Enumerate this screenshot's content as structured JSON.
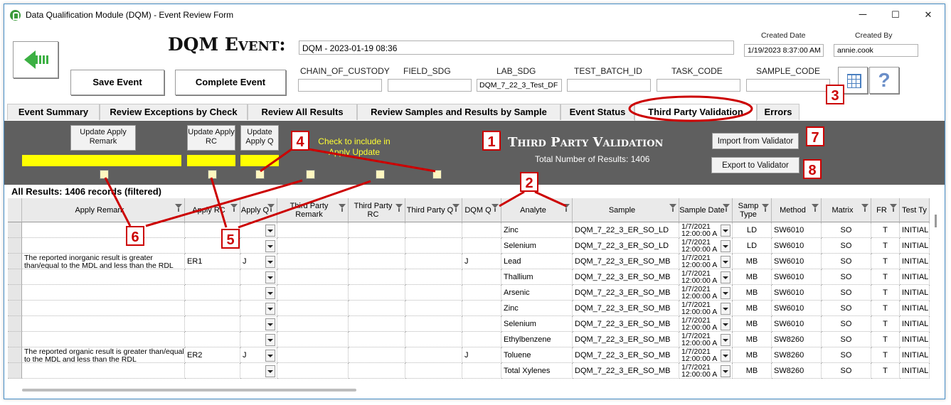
{
  "window": {
    "title": "Data Qualification Module (DQM) - Event Review Form",
    "minimize": "─",
    "maximize": "☐",
    "close": "✕"
  },
  "header": {
    "title": "DQM Event:",
    "event_name": "DQM - 2023-01-19 08:36",
    "created_date_label": "Created Date",
    "created_date": "1/19/2023 8:37:00 AM",
    "created_by_label": "Created By",
    "created_by": "annie.cook",
    "save_label": "Save Event",
    "complete_label": "Complete Event",
    "fields": [
      {
        "label": "CHAIN_OF_CUSTODY",
        "value": ""
      },
      {
        "label": "FIELD_SDG",
        "value": ""
      },
      {
        "label": "LAB_SDG",
        "value": "DQM_7_22_3_Test_DF"
      },
      {
        "label": "TEST_BATCH_ID",
        "value": ""
      },
      {
        "label": "TASK_CODE",
        "value": ""
      },
      {
        "label": "SAMPLE_CODE",
        "value": ""
      }
    ],
    "help_glyph": "?"
  },
  "tabs": [
    "Event Summary",
    "Review Exceptions by Check",
    "Review All Results",
    "Review Samples and Results by Sample",
    "Event Status",
    "Third Party Validation",
    "Errors"
  ],
  "panel": {
    "update_remark": "Update Apply Remark",
    "update_rc": "Update Apply RC",
    "update_q": "Update Apply Q",
    "check_note": "Check to include in Apply Update",
    "title": "Third Party Validation",
    "total": "Total Number of Results: 1406",
    "import_label": "Import from Validator",
    "export_label": "Export to Validator"
  },
  "results_label": "All Results: 1406 records (filtered)",
  "table": {
    "columns": [
      "Apply Remark",
      "Apply RC",
      "Apply Q",
      "Third Party Remark",
      "Third Party RC",
      "Third Party Q",
      "DQM Q",
      "Analyte",
      "Sample",
      "Sample Date",
      "Samp Type",
      "Method",
      "Matrix",
      "FR",
      "Test Ty"
    ],
    "rows": [
      {
        "remark": "",
        "rc": "",
        "q": "",
        "dqmq": "",
        "analyte": "Zinc",
        "sample": "DQM_7_22_3_ER_SO_LD",
        "date": "1/7/2021 12:00:00 A",
        "type": "LD",
        "method": "SW6010",
        "matrix": "SO",
        "fr": "T",
        "test": "INITIAL"
      },
      {
        "remark": "",
        "rc": "",
        "q": "",
        "dqmq": "",
        "analyte": "Selenium",
        "sample": "DQM_7_22_3_ER_SO_LD",
        "date": "1/7/2021 12:00:00 A",
        "type": "LD",
        "method": "SW6010",
        "matrix": "SO",
        "fr": "T",
        "test": "INITIAL"
      },
      {
        "remark": "The reported inorganic result is greater than/equal to the MDL and less than the RDL",
        "rc": "ER1",
        "q": "J",
        "dqmq": "J",
        "analyte": "Lead",
        "sample": "DQM_7_22_3_ER_SO_MB",
        "date": "1/7/2021 12:00:00 A",
        "type": "MB",
        "method": "SW6010",
        "matrix": "SO",
        "fr": "T",
        "test": "INITIAL"
      },
      {
        "remark": "",
        "rc": "",
        "q": "",
        "dqmq": "",
        "analyte": "Thallium",
        "sample": "DQM_7_22_3_ER_SO_MB",
        "date": "1/7/2021 12:00:00 A",
        "type": "MB",
        "method": "SW6010",
        "matrix": "SO",
        "fr": "T",
        "test": "INITIAL"
      },
      {
        "remark": "",
        "rc": "",
        "q": "",
        "dqmq": "",
        "analyte": "Arsenic",
        "sample": "DQM_7_22_3_ER_SO_MB",
        "date": "1/7/2021 12:00:00 A",
        "type": "MB",
        "method": "SW6010",
        "matrix": "SO",
        "fr": "T",
        "test": "INITIAL"
      },
      {
        "remark": "",
        "rc": "",
        "q": "",
        "dqmq": "",
        "analyte": "Zinc",
        "sample": "DQM_7_22_3_ER_SO_MB",
        "date": "1/7/2021 12:00:00 A",
        "type": "MB",
        "method": "SW6010",
        "matrix": "SO",
        "fr": "T",
        "test": "INITIAL"
      },
      {
        "remark": "",
        "rc": "",
        "q": "",
        "dqmq": "",
        "analyte": "Selenium",
        "sample": "DQM_7_22_3_ER_SO_MB",
        "date": "1/7/2021 12:00:00 A",
        "type": "MB",
        "method": "SW6010",
        "matrix": "SO",
        "fr": "T",
        "test": "INITIAL"
      },
      {
        "remark": "",
        "rc": "",
        "q": "",
        "dqmq": "",
        "analyte": "Ethylbenzene",
        "sample": "DQM_7_22_3_ER_SO_MB",
        "date": "1/7/2021 12:00:00 A",
        "type": "MB",
        "method": "SW8260",
        "matrix": "SO",
        "fr": "T",
        "test": "INITIAL"
      },
      {
        "remark": "The reported organic result is greater than/equal to the MDL and less than the RDL",
        "rc": "ER2",
        "q": "J",
        "dqmq": "J",
        "analyte": "Toluene",
        "sample": "DQM_7_22_3_ER_SO_MB",
        "date": "1/7/2021 12:00:00 A",
        "type": "MB",
        "method": "SW8260",
        "matrix": "SO",
        "fr": "T",
        "test": "INITIAL"
      },
      {
        "remark": "",
        "rc": "",
        "q": "",
        "dqmq": "",
        "analyte": "Total Xylenes",
        "sample": "DQM_7_22_3_ER_SO_MB",
        "date": "1/7/2021 12:00:00 A",
        "type": "MB",
        "method": "SW8260",
        "matrix": "SO",
        "fr": "T",
        "test": "INITIAL"
      }
    ]
  },
  "annotations": [
    "1",
    "2",
    "3",
    "4",
    "5",
    "6",
    "7",
    "8"
  ],
  "colors": {
    "annotation": "#cc0000",
    "panel": "#5f5f5f",
    "highlight": "#ffff00",
    "note_text": "#ffff33"
  }
}
